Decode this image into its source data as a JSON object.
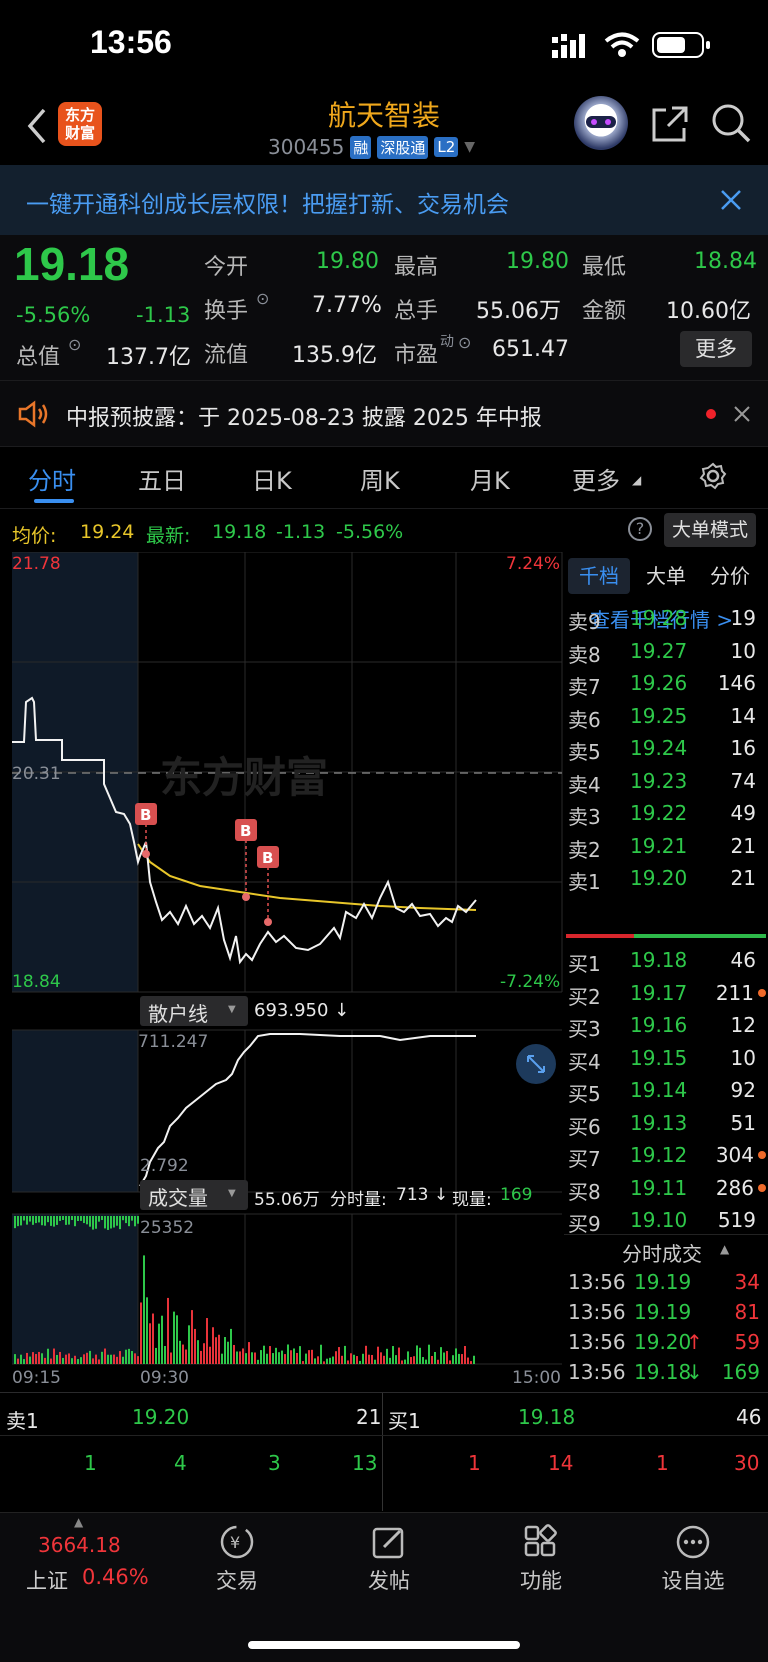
{
  "status_bar": {
    "time": "13:56"
  },
  "header": {
    "logo_text": "东方\n财富",
    "title": "航天智装",
    "code": "300455",
    "badges": [
      "融",
      "深股通",
      "L2"
    ]
  },
  "banner": {
    "text": "一键开通科创成长层权限！把握打新、交易机会"
  },
  "quote": {
    "price": "19.18",
    "change_pct": "-5.56%",
    "change": "-1.13",
    "fields": [
      {
        "label": "今开",
        "value": "19.80",
        "color": "green"
      },
      {
        "label": "最高",
        "value": "19.80",
        "color": "green"
      },
      {
        "label": "最低",
        "value": "18.84",
        "color": "green"
      },
      {
        "label": "换手",
        "value": "7.77%",
        "color": "white"
      },
      {
        "label": "总手",
        "value": "55.06万",
        "color": "white"
      },
      {
        "label": "金额",
        "value": "10.60亿",
        "color": "white"
      },
      {
        "label": "总值",
        "value": "137.7亿",
        "color": "white"
      },
      {
        "label": "流值",
        "value": "135.9亿",
        "color": "white"
      },
      {
        "label": "市盈",
        "value": "651.47",
        "color": "white"
      }
    ],
    "pe_sup": "动",
    "more_button": "更多"
  },
  "notice": {
    "text": "中报预披露：于 2025-08-23 披露 2025 年中报"
  },
  "tabs": [
    "分时",
    "五日",
    "日K",
    "周K",
    "月K",
    "更多"
  ],
  "avg_line": {
    "avg_label": "均价:",
    "avg_value": "19.24",
    "latest_label": "最新:",
    "latest_value": "19.18",
    "latest_change": "-1.13",
    "latest_pct": "-5.56%",
    "mode_button": "大单模式"
  },
  "chart": {
    "price_high": "21.78",
    "price_low": "18.84",
    "pct_high": "7.24%",
    "pct_low": "-7.24%",
    "prev_close": "20.31",
    "watermark": "东方财富",
    "markers": [
      "B",
      "B",
      "B"
    ],
    "retail_label": "散户线",
    "retail_value": "693.950 ↓",
    "retail_max": "711.247",
    "retail_min": "2.792",
    "volume_label": "成交量",
    "volume_total": "55.06万",
    "volume_minute_label": "分时量:",
    "volume_minute_value": "713 ↓",
    "volume_now_label": "现量:",
    "volume_now_value": "169",
    "volume_max": "25352",
    "time_start": "09:15",
    "time_open": "09:30",
    "time_end": "15:00"
  },
  "book": {
    "tabs": [
      "千档",
      "大单",
      "分价"
    ],
    "view_link": "查看千档行情 >",
    "asks": [
      {
        "label": "卖9",
        "price": "19.28",
        "vol": "19"
      },
      {
        "label": "卖8",
        "price": "19.27",
        "vol": "10"
      },
      {
        "label": "卖7",
        "price": "19.26",
        "vol": "146"
      },
      {
        "label": "卖6",
        "price": "19.25",
        "vol": "14"
      },
      {
        "label": "卖5",
        "price": "19.24",
        "vol": "16"
      },
      {
        "label": "卖4",
        "price": "19.23",
        "vol": "74"
      },
      {
        "label": "卖3",
        "price": "19.22",
        "vol": "49"
      },
      {
        "label": "卖2",
        "price": "19.21",
        "vol": "21"
      },
      {
        "label": "卖1",
        "price": "19.20",
        "vol": "21"
      }
    ],
    "bids": [
      {
        "label": "买1",
        "price": "19.18",
        "vol": "46",
        "dot": false
      },
      {
        "label": "买2",
        "price": "19.17",
        "vol": "211",
        "dot": true
      },
      {
        "label": "买3",
        "price": "19.16",
        "vol": "12",
        "dot": false
      },
      {
        "label": "买4",
        "price": "19.15",
        "vol": "10",
        "dot": false
      },
      {
        "label": "买5",
        "price": "19.14",
        "vol": "92",
        "dot": false
      },
      {
        "label": "买6",
        "price": "19.13",
        "vol": "51",
        "dot": false
      },
      {
        "label": "买7",
        "price": "19.12",
        "vol": "304",
        "dot": true
      },
      {
        "label": "买8",
        "price": "19.11",
        "vol": "286",
        "dot": true
      },
      {
        "label": "买9",
        "price": "19.10",
        "vol": "519",
        "dot": false
      }
    ],
    "trades_title": "分时成交",
    "trades": [
      {
        "time": "13:56",
        "price": "19.19",
        "vol": "34",
        "dir": "",
        "vcolor": "red"
      },
      {
        "time": "13:56",
        "price": "19.19",
        "vol": "81",
        "dir": "",
        "vcolor": "red"
      },
      {
        "time": "13:56",
        "price": "19.20",
        "vol": "59",
        "dir": "↑",
        "vcolor": "red"
      },
      {
        "time": "13:56",
        "price": "19.18",
        "vol": "169",
        "dir": "↓",
        "vcolor": "green"
      }
    ]
  },
  "bottom_quote": {
    "sell_label": "卖1",
    "sell_price": "19.20",
    "sell_vol": "21",
    "buy_label": "买1",
    "buy_price": "19.18",
    "buy_vol": "46",
    "sell_queue": [
      "1",
      "4",
      "3",
      "13"
    ],
    "buy_queue": [
      "1",
      "14",
      "1",
      "30"
    ]
  },
  "nav": {
    "index_value": "3664.18",
    "index_name": "上证",
    "index_pct": "0.46%",
    "items": [
      "交易",
      "发帖",
      "功能",
      "设自选"
    ]
  }
}
